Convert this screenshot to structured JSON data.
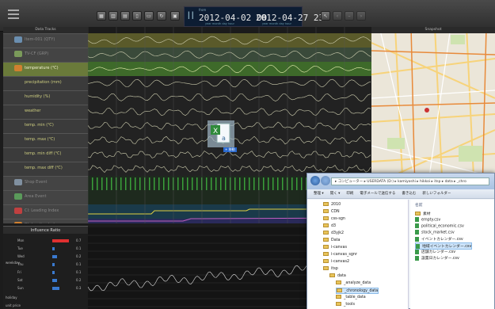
{
  "header": {
    "from_label": "from",
    "from_date": "2012-04-02 00",
    "to_date": "2012-04-27 23",
    "date_sub": "year  month  day  hour"
  },
  "panels": {
    "data_tracks": "Data Tracks",
    "snapshot": "Snapshot",
    "influence_ratio": "Influence Ratio"
  },
  "tracks": [
    {
      "label": "Item-001 (QTY)",
      "dim": true
    },
    {
      "label": "TV-CF (GRP)",
      "dim": true
    },
    {
      "label": "temperature (℃)",
      "sel": true
    },
    {
      "label": "precipitation (mm)"
    },
    {
      "label": "humidity (%)"
    },
    {
      "label": "weather"
    },
    {
      "label": "temp. min (℃)"
    },
    {
      "label": "temp. max (℃)"
    },
    {
      "label": "temp. min diff (℃)"
    },
    {
      "label": "temp. max diff (℃)"
    },
    {
      "label": "Shop Event",
      "dim": true
    },
    {
      "label": "Area Event",
      "dim": true
    },
    {
      "label": "CI: Leading Index",
      "dim": true
    },
    {
      "label": "DI: Leading Index",
      "dim": true
    }
  ],
  "influence": {
    "group_label": "weekday",
    "days": [
      {
        "label": "Mon",
        "value": 0.7,
        "color": "#e03030"
      },
      {
        "label": "Tue",
        "value": 0.1,
        "color": "#3a7ad0"
      },
      {
        "label": "Wed",
        "value": 0.2,
        "color": "#3a7ad0"
      },
      {
        "label": "Thu",
        "value": 0.1,
        "color": "#3a7ad0"
      },
      {
        "label": "Fri",
        "value": 0.1,
        "color": "#3a7ad0"
      },
      {
        "label": "Sat",
        "value": 0.2,
        "color": "#3a7ad0"
      },
      {
        "label": "Sun",
        "value": 0.3,
        "color": "#3a7ad0"
      }
    ],
    "extra_rows": [
      "holiday",
      "unit price"
    ]
  },
  "drag": {
    "badge": "+ 移動"
  },
  "explorer": {
    "address": "▸ コンピューター ▸ USERDATA (D:) ▸ kamiyoshi ▸ hikkoi ▸ itsp ▸ data ▸ _chro",
    "commands": [
      "整理 ▾",
      "開く ▾",
      "印刷",
      "電子メールで送信する",
      "書き込む",
      "新しいフォルダー"
    ],
    "tree": [
      "2010",
      "CDN",
      "css-sgn",
      "d3",
      "d3yjk2",
      "Data",
      "i-canvas",
      "i-canvas_sgnr",
      "i-canvas2",
      "itsp",
      "data",
      "_analyze_data",
      "_chronology_data",
      "_table_data",
      "_tools"
    ],
    "files_header": "名前",
    "files": [
      {
        "name": "素材",
        "type": "folder"
      },
      {
        "name": "empty.csv",
        "type": "file"
      },
      {
        "name": "political_economic.csv",
        "type": "file"
      },
      {
        "name": "stock_market.csv",
        "type": "file"
      },
      {
        "name": "イベントカレンダー.csv",
        "type": "file"
      },
      {
        "name": "地域イベントカレンダー.csv",
        "type": "file",
        "sel": true
      },
      {
        "name": "店舗カレンダー.csv",
        "type": "file"
      },
      {
        "name": "設置日カレンダー.csv",
        "type": "file"
      }
    ]
  },
  "colors": {
    "track_text": "#cfcf80",
    "selected_track": "#6a7a3a",
    "chart_bg": "#1b1b1b",
    "line": "#d8d8c0"
  }
}
